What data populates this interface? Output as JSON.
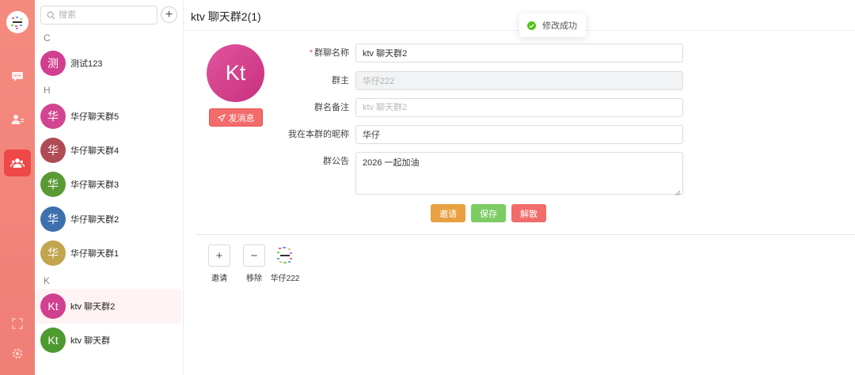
{
  "colors": {
    "rail": "#f07f76",
    "rail_active": "#ee4848",
    "invite": "#e8a040",
    "save": "#7ccc64",
    "dissolve": "#f26b6b",
    "toast_success": "#52c41a"
  },
  "rail": {
    "items": [
      {
        "icon": "chat-icon"
      },
      {
        "icon": "contacts-icon"
      },
      {
        "icon": "group-icon",
        "active": true
      },
      {
        "icon": "fullscreen-icon"
      },
      {
        "icon": "settings-icon"
      }
    ]
  },
  "search": {
    "placeholder": "搜索"
  },
  "list": {
    "sections": [
      {
        "letter": "C",
        "items": [
          {
            "avatar": "测",
            "name": "测试123",
            "color": "#d13f8f"
          }
        ]
      },
      {
        "letter": "H",
        "items": [
          {
            "avatar": "华",
            "name": "华仔聊天群5",
            "color": "#d24590"
          },
          {
            "avatar": "华",
            "name": "华仔聊天群4",
            "color": "#b04a55"
          },
          {
            "avatar": "华",
            "name": "华仔聊天群3",
            "color": "#5a9a36"
          },
          {
            "avatar": "华",
            "name": "华仔聊天群2",
            "color": "#3f70ae"
          },
          {
            "avatar": "华",
            "name": "华仔聊天群1",
            "color": "#c2a54e"
          }
        ]
      },
      {
        "letter": "K",
        "items": [
          {
            "avatar": "Kt",
            "name": "ktv 聊天群2",
            "color": "#d13f8f",
            "active": true
          },
          {
            "avatar": "Kt",
            "name": "ktv 聊天群",
            "color": "#4f9a30"
          }
        ]
      }
    ]
  },
  "main": {
    "title": "ktv 聊天群2(1)",
    "toast": "修改成功",
    "avatar": "Kt",
    "send_label": "发消息",
    "form": {
      "required_mark": "*",
      "name_label": "群聊名称",
      "name_value": "ktv 聊天群2",
      "owner_label": "群主",
      "owner_value": "华仔222",
      "remark_label": "群名备注",
      "remark_placeholder": "ktv 聊天群2",
      "nickname_label": "我在本群的昵称",
      "nickname_value": "华仔",
      "notice_label": "群公告",
      "notice_value": "2026 一起加油"
    },
    "actions": {
      "invite": "邀请",
      "save": "保存",
      "dissolve": "解散"
    },
    "members": {
      "add_label": "邀请",
      "remove_label": "移除",
      "people": [
        {
          "name": "华仔222"
        }
      ]
    }
  }
}
